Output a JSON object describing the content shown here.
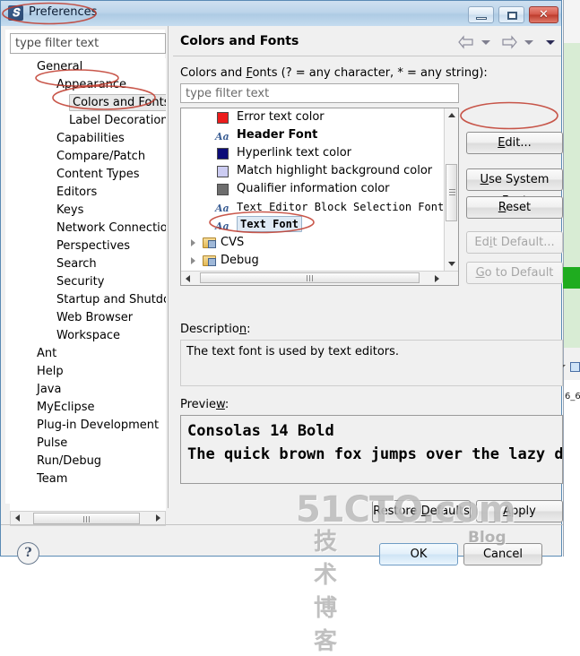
{
  "window": {
    "title": "Preferences",
    "icon": "eclipse-icon",
    "controls": {
      "minimize": "minimize-button",
      "maximize": "maximize-button",
      "close": "✕"
    }
  },
  "sidebar": {
    "filter_placeholder": "type filter text",
    "items": [
      {
        "label": "General",
        "level": 0,
        "selected": false
      },
      {
        "label": "Appearance",
        "level": 1,
        "selected": false
      },
      {
        "label": "Colors and Fonts",
        "level": 2,
        "selected": true
      },
      {
        "label": "Label Decorations",
        "level": 2,
        "selected": false
      },
      {
        "label": "Capabilities",
        "level": 1,
        "selected": false
      },
      {
        "label": "Compare/Patch",
        "level": 1,
        "selected": false
      },
      {
        "label": "Content Types",
        "level": 1,
        "selected": false
      },
      {
        "label": "Editors",
        "level": 1,
        "selected": false
      },
      {
        "label": "Keys",
        "level": 1,
        "selected": false
      },
      {
        "label": "Network Connections",
        "level": 1,
        "selected": false
      },
      {
        "label": "Perspectives",
        "level": 1,
        "selected": false
      },
      {
        "label": "Search",
        "level": 1,
        "selected": false
      },
      {
        "label": "Security",
        "level": 1,
        "selected": false
      },
      {
        "label": "Startup and Shutdown",
        "level": 1,
        "selected": false
      },
      {
        "label": "Web Browser",
        "level": 1,
        "selected": false
      },
      {
        "label": "Workspace",
        "level": 1,
        "selected": false
      },
      {
        "label": "Ant",
        "level": 0,
        "selected": false
      },
      {
        "label": "Help",
        "level": 0,
        "selected": false
      },
      {
        "label": "Java",
        "level": 0,
        "selected": false
      },
      {
        "label": "MyEclipse",
        "level": 0,
        "selected": false
      },
      {
        "label": "Plug-in Development",
        "level": 0,
        "selected": false
      },
      {
        "label": "Pulse",
        "level": 0,
        "selected": false
      },
      {
        "label": "Run/Debug",
        "level": 0,
        "selected": false
      },
      {
        "label": "Team",
        "level": 0,
        "selected": false
      }
    ]
  },
  "page": {
    "title": "Colors and Fonts",
    "filter_label": "Colors and Fonts (? = any character, * = any string):",
    "filter_label_pre": "Colors and ",
    "filter_label_mnemonic": "F",
    "filter_label_post": "onts (? = any character, * = any string):",
    "filter_placeholder": "type filter text"
  },
  "font_list": {
    "rows": [
      {
        "label": "Error text color",
        "kind": "swatch",
        "color": "#ec1c1c",
        "selected": false,
        "bold": false,
        "mono": false
      },
      {
        "label": "Header Font",
        "kind": "font",
        "color": "",
        "selected": false,
        "bold": true,
        "mono": false
      },
      {
        "label": "Hyperlink text color",
        "kind": "swatch",
        "color": "#0c0c78",
        "selected": false,
        "bold": false,
        "mono": false
      },
      {
        "label": "Match highlight background color",
        "kind": "swatch",
        "color": "#ccccf2",
        "selected": false,
        "bold": false,
        "mono": false
      },
      {
        "label": "Qualifier information color",
        "kind": "swatch",
        "color": "#6e6e6e",
        "selected": false,
        "bold": false,
        "mono": false
      },
      {
        "label": "Text Editor Block Selection Font",
        "kind": "font",
        "color": "",
        "selected": false,
        "bold": false,
        "mono": true
      },
      {
        "label": "Text Font",
        "kind": "font",
        "color": "",
        "selected": true,
        "bold": true,
        "mono": true
      },
      {
        "label": "CVS",
        "kind": "folder",
        "color": "",
        "selected": false,
        "bold": false,
        "mono": false
      },
      {
        "label": "Debug",
        "kind": "folder",
        "color": "",
        "selected": false,
        "bold": false,
        "mono": false
      }
    ]
  },
  "side_buttons": [
    {
      "label": "Edit...",
      "pre": "",
      "mnemonic": "E",
      "post": "dit...",
      "enabled": true
    },
    {
      "label": "Use System Font",
      "pre": "",
      "mnemonic": "U",
      "post": "se System Font",
      "enabled": true
    },
    {
      "label": "Reset",
      "pre": "",
      "mnemonic": "R",
      "post": "eset",
      "enabled": true
    },
    {
      "label": "Edit Default...",
      "pre": "Ed",
      "mnemonic": "i",
      "post": "t Default...",
      "enabled": false
    },
    {
      "label": "Go to Default",
      "pre": "",
      "mnemonic": "G",
      "post": "o to Default",
      "enabled": false
    }
  ],
  "description": {
    "label": "Description:",
    "label_pre": "Descriptio",
    "label_mnemonic": "n",
    "label_post": ":",
    "text": "The text font is used by text editors."
  },
  "preview": {
    "label": "Preview:",
    "label_pre": "Previe",
    "label_mnemonic": "w",
    "label_post": ":",
    "line1": "Consolas 14 Bold",
    "line2": "The quick brown fox jumps over the lazy d"
  },
  "bottom_buttons": {
    "restore_defaults_pre": "Restore ",
    "restore_defaults_mnemonic": "D",
    "restore_defaults_post": "efaults",
    "apply_pre": "",
    "apply_mnemonic": "A",
    "apply_post": "pply",
    "ok": "OK",
    "cancel": "Cancel"
  },
  "help": {
    "glyph": "?"
  },
  "watermark": {
    "line1": "51CTO.com",
    "line2": "技术博客",
    "line3": "Blog"
  },
  "background": {
    "small_text": "6_6"
  },
  "annotation_color": "#c0392b"
}
